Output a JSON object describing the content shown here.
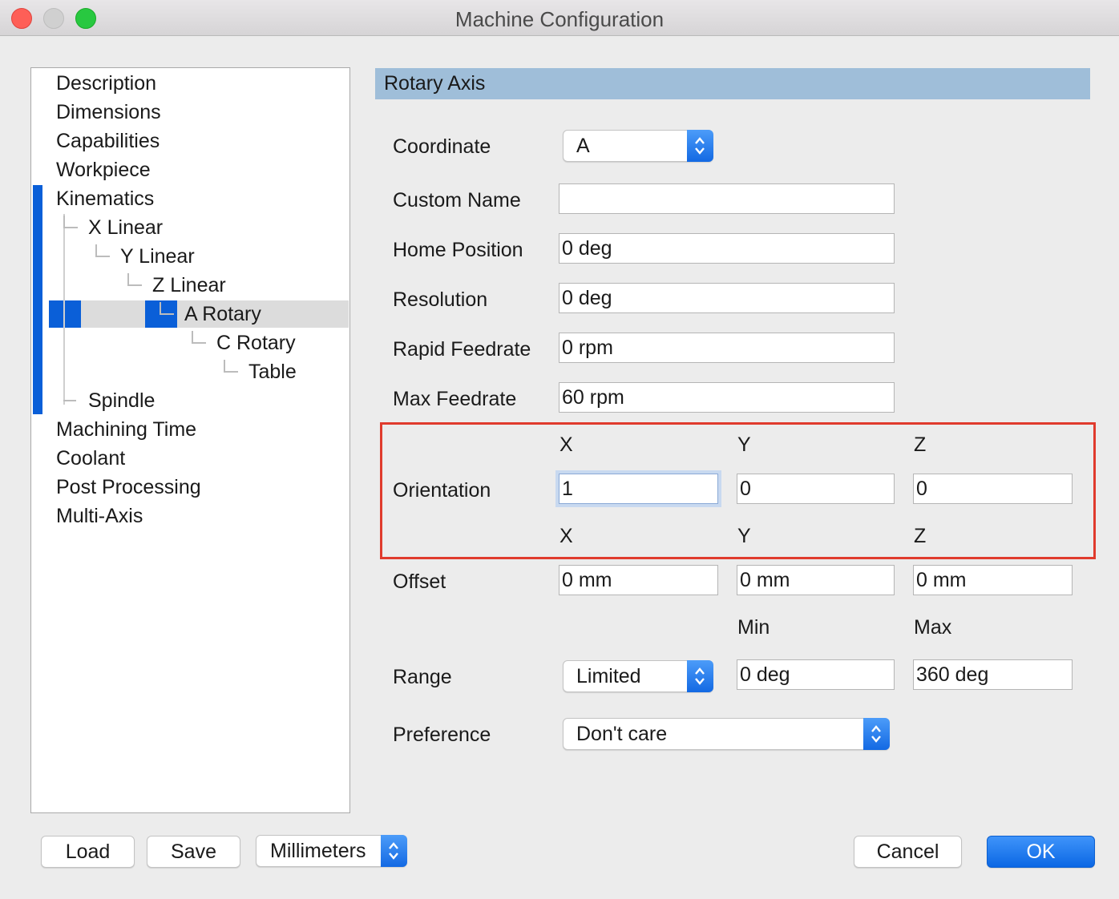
{
  "window": {
    "title": "Machine Configuration"
  },
  "tree": {
    "items": [
      {
        "label": "Description"
      },
      {
        "label": "Dimensions"
      },
      {
        "label": "Capabilities"
      },
      {
        "label": "Workpiece"
      },
      {
        "label": "Kinematics"
      },
      {
        "label": "X Linear"
      },
      {
        "label": "Y Linear"
      },
      {
        "label": "Z Linear"
      },
      {
        "label": "A Rotary"
      },
      {
        "label": "C Rotary"
      },
      {
        "label": "Table"
      },
      {
        "label": "Spindle"
      },
      {
        "label": "Machining Time"
      },
      {
        "label": "Coolant"
      },
      {
        "label": "Post Processing"
      },
      {
        "label": "Multi-Axis"
      }
    ],
    "selected": "A Rotary"
  },
  "panel": {
    "header": "Rotary Axis",
    "coordinate": {
      "label": "Coordinate",
      "value": "A"
    },
    "custom_name": {
      "label": "Custom Name",
      "value": ""
    },
    "home_position": {
      "label": "Home Position",
      "value": "0 deg"
    },
    "resolution": {
      "label": "Resolution",
      "value": "0 deg"
    },
    "rapid_feedrate": {
      "label": "Rapid Feedrate",
      "value": "0 rpm"
    },
    "max_feedrate": {
      "label": "Max Feedrate",
      "value": "60 rpm"
    },
    "orientation": {
      "label": "Orientation",
      "col_x": "X",
      "col_y": "Y",
      "col_z": "Z",
      "x": "1",
      "y": "0",
      "z": "0"
    },
    "offset": {
      "label": "Offset",
      "col_x": "X",
      "col_y": "Y",
      "col_z": "Z",
      "x": "0 mm",
      "y": "0 mm",
      "z": "0 mm"
    },
    "range": {
      "label": "Range",
      "min_label": "Min",
      "max_label": "Max",
      "mode": "Limited",
      "min": "0 deg",
      "max": "360 deg"
    },
    "preference": {
      "label": "Preference",
      "value": "Don't care"
    }
  },
  "footer": {
    "load": "Load",
    "save": "Save",
    "units": "Millimeters",
    "cancel": "Cancel",
    "ok": "OK"
  },
  "colors": {
    "accent": "#0a5fd8",
    "header_bg": "#9fbed9",
    "highlight_border": "#e03b2d"
  }
}
